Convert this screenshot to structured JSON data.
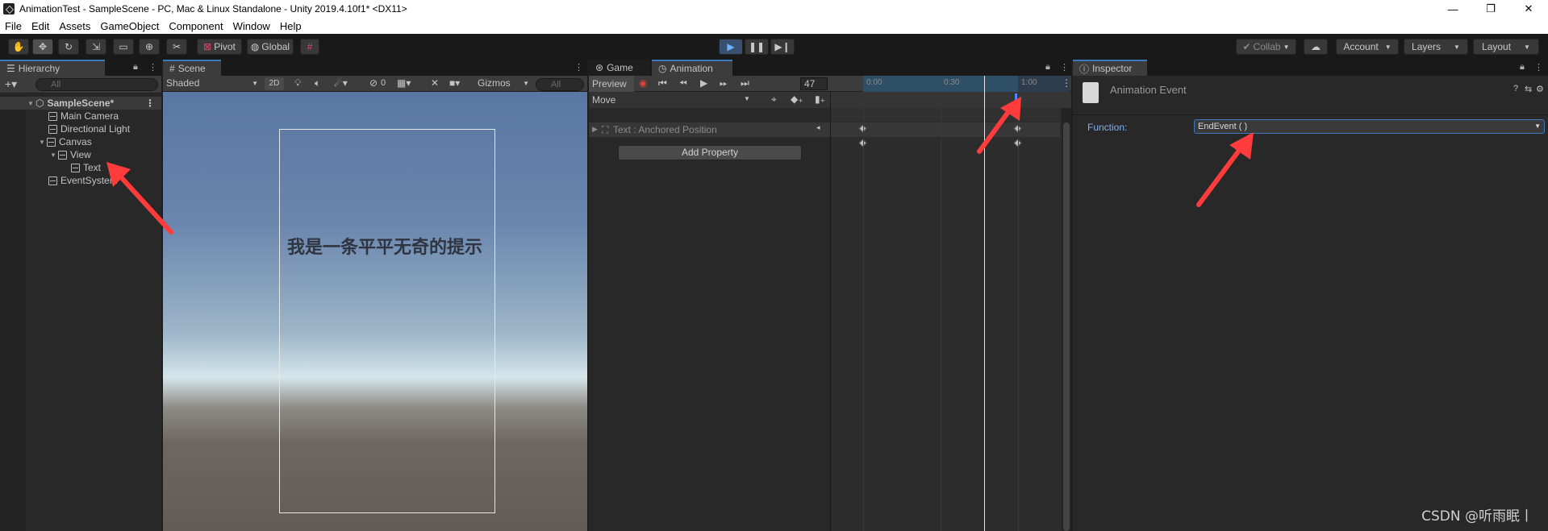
{
  "window": {
    "title": "AnimationTest - SampleScene - PC, Mac & Linux Standalone - Unity 2019.4.10f1* <DX11>",
    "controls": [
      "—",
      "❐",
      "✕"
    ]
  },
  "menu": [
    "File",
    "Edit",
    "Assets",
    "GameObject",
    "Component",
    "Window",
    "Help"
  ],
  "toolbar": {
    "pivot": "Pivot",
    "global": "Global",
    "collab": "Collab",
    "account": "Account",
    "layers": "Layers",
    "layout": "Layout"
  },
  "hierarchy": {
    "tab": "Hierarchy",
    "search_placeholder": "All",
    "scene": "SampleScene*",
    "items": [
      "Main Camera",
      "Directional Light",
      "Canvas",
      "View",
      "Text",
      "EventSystem"
    ]
  },
  "scene": {
    "tab": "Scene",
    "shading": "Shaded",
    "mode_2d": "2D",
    "hidden_count": "0",
    "gizmos": "Gizmos",
    "search_placeholder": "All",
    "canvas_text": "我是一条平平无奇的提示"
  },
  "animation": {
    "tabs": [
      "Game",
      "Animation"
    ],
    "preview": "Preview",
    "frame": "47",
    "clip": "Move",
    "property": "Text : Anchored Position",
    "add_property": "Add Property",
    "ticks": [
      "0:00",
      "0:30",
      "1:00"
    ]
  },
  "inspector": {
    "tab": "Inspector",
    "title": "Animation Event",
    "function_label": "Function:",
    "function_value": "EndEvent ( )"
  },
  "watermark": "CSDN @听雨眠丨",
  "colors": {
    "accent": "#3a79bb",
    "annotation_arrow": "#ff3b3b",
    "event_marker": "#4a8cff"
  }
}
